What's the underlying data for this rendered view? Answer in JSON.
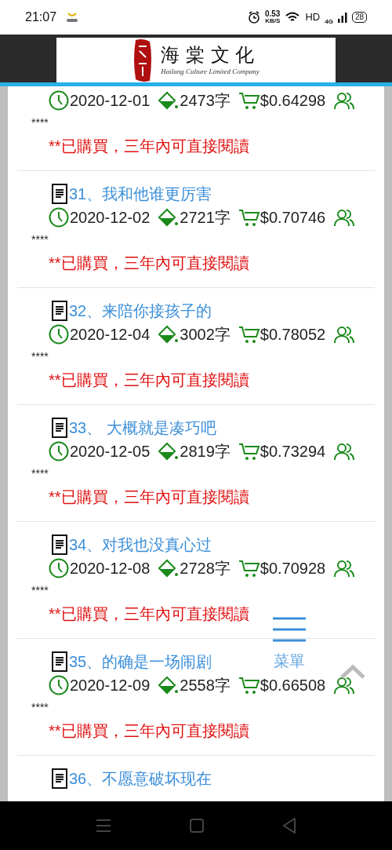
{
  "status_bar": {
    "time": "21:07",
    "speed": "0.53",
    "speed_unit": "KB/S",
    "hd": "HD",
    "network": "4G",
    "battery": "28"
  },
  "header": {
    "logo_title": "海 棠 文 化",
    "logo_subtitle": "Hailang Culture Limited Company"
  },
  "chapters": [
    {
      "date": "2020-12-01",
      "words": "2473字",
      "price": "$0.64298",
      "stars": "****",
      "note": "**已購買，三年內可直接閱讀"
    },
    {
      "title": "31、我和他谁更厉害",
      "date": "2020-12-02",
      "words": "2721字",
      "price": "$0.70746",
      "stars": "****",
      "note": "**已購買，三年內可直接閱讀"
    },
    {
      "title": "32、来陪你接孩子的",
      "date": "2020-12-04",
      "words": "3002字",
      "price": "$0.78052",
      "stars": "****",
      "note": "**已購買，三年內可直接閱讀"
    },
    {
      "title": "33、 大概就是凑巧吧",
      "date": "2020-12-05",
      "words": "2819字",
      "price": "$0.73294",
      "stars": "****",
      "note": "**已購買，三年內可直接閱讀"
    },
    {
      "title": "34、对我也没真心过",
      "date": "2020-12-08",
      "words": "2728字",
      "price": "$0.70928",
      "stars": "****",
      "note": "**已購買，三年內可直接閱讀"
    },
    {
      "title": "35、的确是一场闹剧",
      "date": "2020-12-09",
      "words": "2558字",
      "price": "$0.66508",
      "stars": "****",
      "note": "**已購買，三年內可直接閱讀"
    },
    {
      "title": "36、不愿意破坏现在"
    }
  ],
  "menu_button": {
    "label": "菜單"
  }
}
